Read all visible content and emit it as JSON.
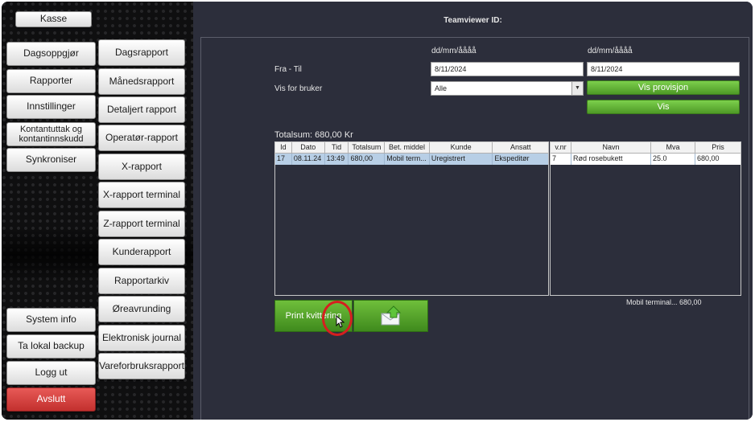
{
  "sidebar": {
    "top_button": "Kasse",
    "col1": [
      "Dagsoppgjør",
      "Rapporter",
      "Innstillinger",
      "Kontantuttak og kontantinnskudd",
      "Synkroniser"
    ],
    "col1_bottom": [
      "System info",
      "Ta lokal backup",
      "Logg ut",
      "Avslutt"
    ],
    "col2": [
      "Dagsrapport",
      "Månedsrapport",
      "Detaljert rapport",
      "Operatør-rapport",
      "X-rapport",
      "X-rapport terminal",
      "Z-rapport terminal",
      "Kunderapport",
      "Rapportarkiv",
      "Øreavrunding",
      "Elektronisk journal",
      "Vareforbruksrapport"
    ]
  },
  "header": {
    "teamviewer": "Teamviewer ID:"
  },
  "filters": {
    "date_format_from": "dd/mm/åååå",
    "date_format_to": "dd/mm/åååå",
    "fra_til_label": "Fra - Til",
    "from_value": "8/11/2024",
    "to_value": "8/11/2024",
    "vis_for_bruker_label": "Vis for bruker",
    "bruker_selected": "Alle",
    "vis_provisjon_label": "Vis provisjon",
    "vis_label": "Vis"
  },
  "totalsum": "Totalsum: 680,00 Kr",
  "sales_table": {
    "headers": [
      "Id",
      "Dato",
      "Tid",
      "Totalsum",
      "Bet. middel",
      "Kunde",
      "Ansatt"
    ],
    "rows": [
      [
        "17",
        "08.11.24",
        "13:49",
        "680,00",
        "Mobil term...",
        "Uregistrert",
        "Ekspeditør"
      ]
    ]
  },
  "items_table": {
    "headers": [
      "v.nr",
      "Navn",
      "Mva",
      "Pris"
    ],
    "rows": [
      [
        "7",
        "Rød rosebukett",
        "25.0",
        "680,00"
      ]
    ]
  },
  "payment_summary": "Mobil terminal... 680,00",
  "actions": {
    "print_label": "Print kvittering"
  },
  "colors": {
    "accent_green": "#5aab2c",
    "danger_red": "#d13b38",
    "panel_bg": "#2c2e3b"
  }
}
